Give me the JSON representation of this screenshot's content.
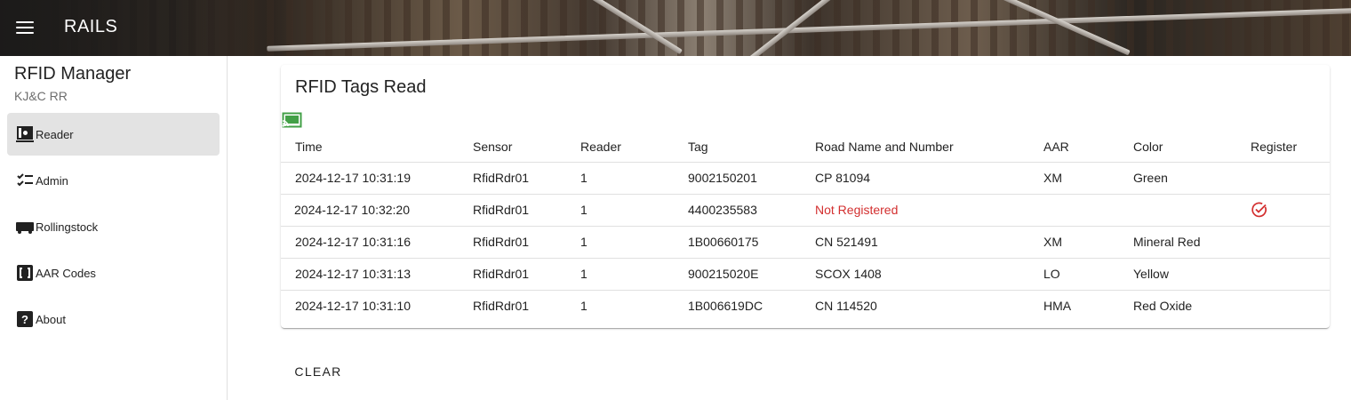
{
  "appbar": {
    "title": "RAILS"
  },
  "sidebar": {
    "title": "RFID Manager",
    "subtitle": "KJ&C RR",
    "items": [
      {
        "label": "Reader",
        "icon": "reader-icon",
        "active": true
      },
      {
        "label": "Admin",
        "icon": "checklist-icon",
        "active": false
      },
      {
        "label": "Rollingstock",
        "icon": "train-car-icon",
        "active": false
      },
      {
        "label": "AAR Codes",
        "icon": "data-array-icon",
        "active": false
      },
      {
        "label": "About",
        "icon": "help-icon",
        "active": false
      }
    ]
  },
  "main": {
    "card_title": "RFID Tags Read",
    "columns": [
      "Time",
      "Sensor",
      "Reader",
      "Tag",
      "Road Name and Number",
      "AAR",
      "Color",
      "Register"
    ],
    "rows": [
      {
        "time": "2024-12-17 10:31:19",
        "sensor": "RfidRdr01",
        "reader": "1",
        "tag": "9002150201",
        "road": "CP 81094",
        "aar": "XM",
        "color": "Green",
        "registered": true
      },
      {
        "time": "2024-12-17 10:32:20",
        "sensor": "RfidRdr01",
        "reader": "1",
        "tag": "4400235583",
        "road": "Not Registered",
        "aar": "",
        "color": "",
        "registered": false
      },
      {
        "time": "2024-12-17 10:31:16",
        "sensor": "RfidRdr01",
        "reader": "1",
        "tag": "1B00660175",
        "road": "CN 521491",
        "aar": "XM",
        "color": "Mineral Red",
        "registered": true
      },
      {
        "time": "2024-12-17 10:31:13",
        "sensor": "RfidRdr01",
        "reader": "1",
        "tag": "900215020E",
        "road": "SCOX 1408",
        "aar": "LO",
        "color": "Yellow",
        "registered": true
      },
      {
        "time": "2024-12-17 10:31:10",
        "sensor": "RfidRdr01",
        "reader": "1",
        "tag": "1B006619DC",
        "road": "CN 114520",
        "aar": "HMA",
        "color": "Red Oxide",
        "registered": true
      }
    ],
    "clear_label": "CLEAR"
  },
  "colors": {
    "cast_icon": "#43a047",
    "not_registered": "#d32f2f",
    "active_nav": "#e3e3e3"
  }
}
